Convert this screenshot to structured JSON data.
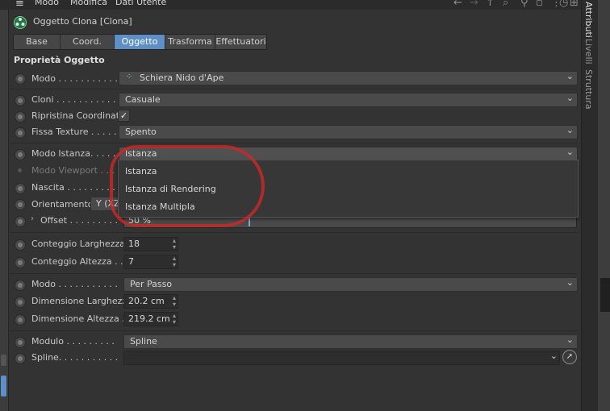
{
  "menubar": {
    "items": [
      "Modo",
      "Modifica",
      "Dati Utente"
    ]
  },
  "object": {
    "title": "Oggetto Clona [Clona]"
  },
  "tabs": [
    "Base",
    "Coord.",
    "Oggetto",
    "Trasforma",
    "Effettuatori"
  ],
  "active_tab": "Oggetto",
  "section": {
    "title": "Proprietà Oggetto"
  },
  "props": {
    "modo": {
      "label": "Modo . . . . . . . . . . .",
      "value": "Schiera Nido d'Ape"
    },
    "cloni": {
      "label": "Cloni . . . . . . . . . . .",
      "value": "Casuale"
    },
    "ripristina": {
      "label": "Ripristina Coordinate",
      "checked": true
    },
    "fissa": {
      "label": "Fissa Texture . . . . .",
      "value": "Spento"
    },
    "modo_istanza": {
      "label": "Modo Istanza. . . . .",
      "value": "Istanza"
    },
    "modo_viewport": {
      "label": "Modo Viewport . . ."
    },
    "nascita": {
      "label": "Nascita . . . . . . . . ."
    },
    "orientamento": {
      "label": "Orientamento",
      "value": "Y (XZ)"
    },
    "offset": {
      "label": "Offset . . . . . . . . .",
      "value": "50 %",
      "fraction": 0.5
    },
    "conteggio_larghezza": {
      "label": "Conteggio Larghezza",
      "value": "18"
    },
    "conteggio_altezza": {
      "label": "Conteggio Altezza . .",
      "value": "7"
    },
    "modo2": {
      "label": "Modo . . . . . . . . . . .",
      "value": "Per Passo"
    },
    "dim_larghezza": {
      "label": "Dimensione Larghezza",
      "value": "20.2 cm"
    },
    "dim_altezza": {
      "label": "Dimensione Altezza .",
      "value": "219.2 cm"
    },
    "modulo": {
      "label": "Modulo . . . . . . . . .",
      "value": "Spline"
    },
    "spline": {
      "label": "Spline. . . . . . . . . . .",
      "value": ""
    }
  },
  "dropdown_popup": {
    "items": [
      "Istanza",
      "Istanza di Rendering",
      "Istanza Multipla"
    ]
  },
  "right_tabs": [
    "Attributi",
    "Livelli",
    "Struttura"
  ],
  "colors": {
    "accent": "#5e8fc7",
    "annotation": "#cd2828"
  }
}
